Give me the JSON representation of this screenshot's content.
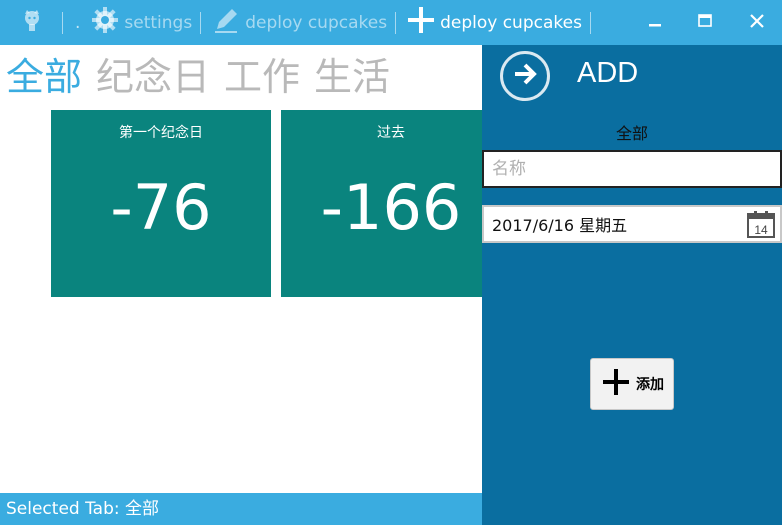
{
  "titlebar": {
    "dot": ".",
    "settings_label": "settings",
    "deploy_label": "deploy cupcakes",
    "add_label": "deploy cupcakes",
    "icons": [
      "github-icon",
      "gear-icon",
      "pen-icon",
      "plus-icon",
      "minimize-icon",
      "maximize-icon",
      "close-icon"
    ]
  },
  "pivot": {
    "tabs": [
      {
        "label": "全部",
        "active": true
      },
      {
        "label": "纪念日",
        "active": false
      },
      {
        "label": "工作",
        "active": false
      },
      {
        "label": "生活",
        "active": false
      }
    ]
  },
  "tiles": [
    {
      "title": "第一个纪念日",
      "value": "-76"
    },
    {
      "title": "过去",
      "value": "-166"
    }
  ],
  "status": {
    "text": "Selected Tab: 全部"
  },
  "pane": {
    "title": "ADD",
    "subtitle": "全部",
    "name_placeholder": "名称",
    "name_value": "",
    "date_value": "2017/6/16 星期五",
    "calendar_day": "14",
    "add_button_label": "添加"
  },
  "colors": {
    "accent": "#3aace0",
    "tile": "#0a847e",
    "pane": "#0a6ea0",
    "inactive_tab": "#b9b9b9"
  }
}
